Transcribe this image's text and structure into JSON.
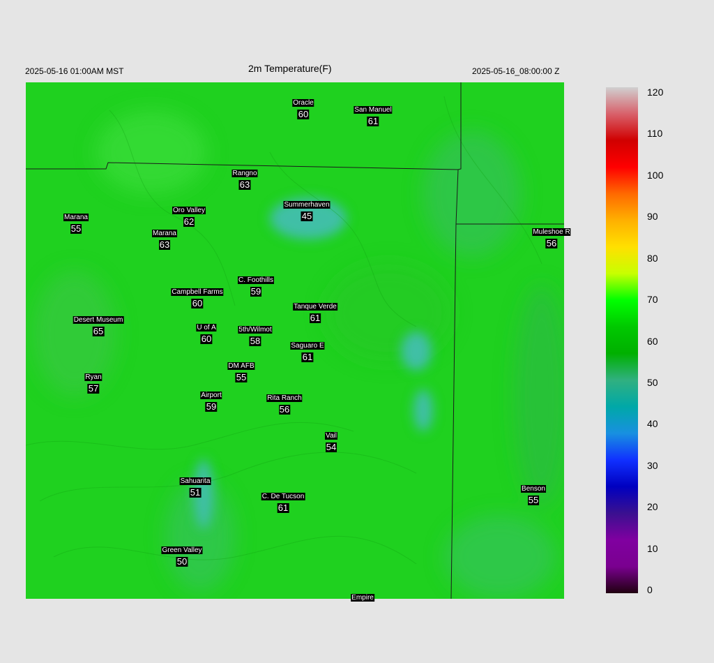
{
  "header": {
    "local_time": "2025-05-16 01:00AM MST",
    "title": "2m Temperature(F)",
    "utc_time": "2025-05-16_08:00:00 Z"
  },
  "colors": {
    "background": "#e5e5e5",
    "map_base": "#1fd11f",
    "cool_patch": "#3fbfa6",
    "boundary": "#1a1a1a"
  },
  "stations": [
    {
      "name": "Oracle",
      "value": "60"
    },
    {
      "name": "San Manuel",
      "value": "61"
    },
    {
      "name": "Rangno",
      "value": "63"
    },
    {
      "name": "Summerhaven",
      "value": "45"
    },
    {
      "name": "Marana",
      "value": "55"
    },
    {
      "name": "Oro Valley",
      "value": "62"
    },
    {
      "name": "Marana",
      "value": "63"
    },
    {
      "name": "Muleshoe R",
      "value": "56"
    },
    {
      "name": "C. Foothills",
      "value": "59"
    },
    {
      "name": "Campbell Farms",
      "value": "60"
    },
    {
      "name": "Tanque Verde",
      "value": "61"
    },
    {
      "name": "Desert Museum",
      "value": "65"
    },
    {
      "name": "U of A",
      "value": "60"
    },
    {
      "name": "5th/Wilmot",
      "value": "58"
    },
    {
      "name": "Saguaro E",
      "value": "61"
    },
    {
      "name": "DM AFB",
      "value": "55"
    },
    {
      "name": "Ryan",
      "value": "57"
    },
    {
      "name": "Airport",
      "value": "59"
    },
    {
      "name": "Rita Ranch",
      "value": "56"
    },
    {
      "name": "Vail",
      "value": "54"
    },
    {
      "name": "Sahuarita",
      "value": "51"
    },
    {
      "name": "C. De Tucson",
      "value": "61"
    },
    {
      "name": "Benson",
      "value": "55"
    },
    {
      "name": "Green Valley",
      "value": "50"
    },
    {
      "name": "Empire",
      "value": ""
    }
  ],
  "colorbar": {
    "labels": [
      "120",
      "110",
      "100",
      "90",
      "80",
      "70",
      "60",
      "50",
      "40",
      "30",
      "20",
      "10",
      "0"
    ],
    "stops": [
      "#d0d0d0",
      "#d8606a",
      "#d00000",
      "#ff0000",
      "#ff6a00",
      "#ffb000",
      "#ffe000",
      "#c8ff00",
      "#00ff00",
      "#00c800",
      "#00b000",
      "#30b080",
      "#00a8a8",
      "#1890e0",
      "#1030ff",
      "#0000c0",
      "#3a1090",
      "#8000a0",
      "#7a0090",
      "#200010"
    ]
  }
}
